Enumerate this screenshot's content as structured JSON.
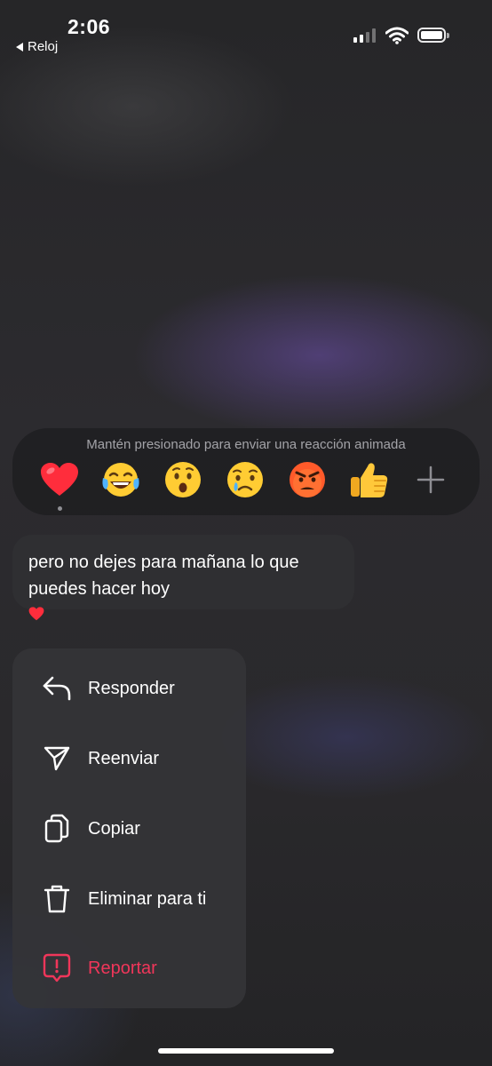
{
  "status_bar": {
    "time": "2:06",
    "back_app": "Reloj"
  },
  "reactions": {
    "hint": "Mantén presionado para enviar una reacción animada",
    "items": [
      {
        "name": "heart",
        "selected": true
      },
      {
        "name": "tears-of-joy"
      },
      {
        "name": "surprised"
      },
      {
        "name": "crying"
      },
      {
        "name": "angry"
      },
      {
        "name": "thumbs-up"
      },
      {
        "name": "add"
      }
    ]
  },
  "message": {
    "text_line1": "pero no dejes para mañana lo que",
    "text_line2": "puedes hacer hoy",
    "reaction": "heart"
  },
  "menu": {
    "items": [
      {
        "label": "Responder",
        "icon": "reply-icon"
      },
      {
        "label": "Reenviar",
        "icon": "send-icon"
      },
      {
        "label": "Copiar",
        "icon": "copy-icon"
      },
      {
        "label": "Eliminar para ti",
        "icon": "trash-icon"
      },
      {
        "label": "Reportar",
        "icon": "report-icon",
        "color": "#f0365a"
      }
    ]
  },
  "colors": {
    "danger": "#f0365a",
    "menu_bg": "#343437",
    "bubble_bg": "#2f2f32"
  }
}
